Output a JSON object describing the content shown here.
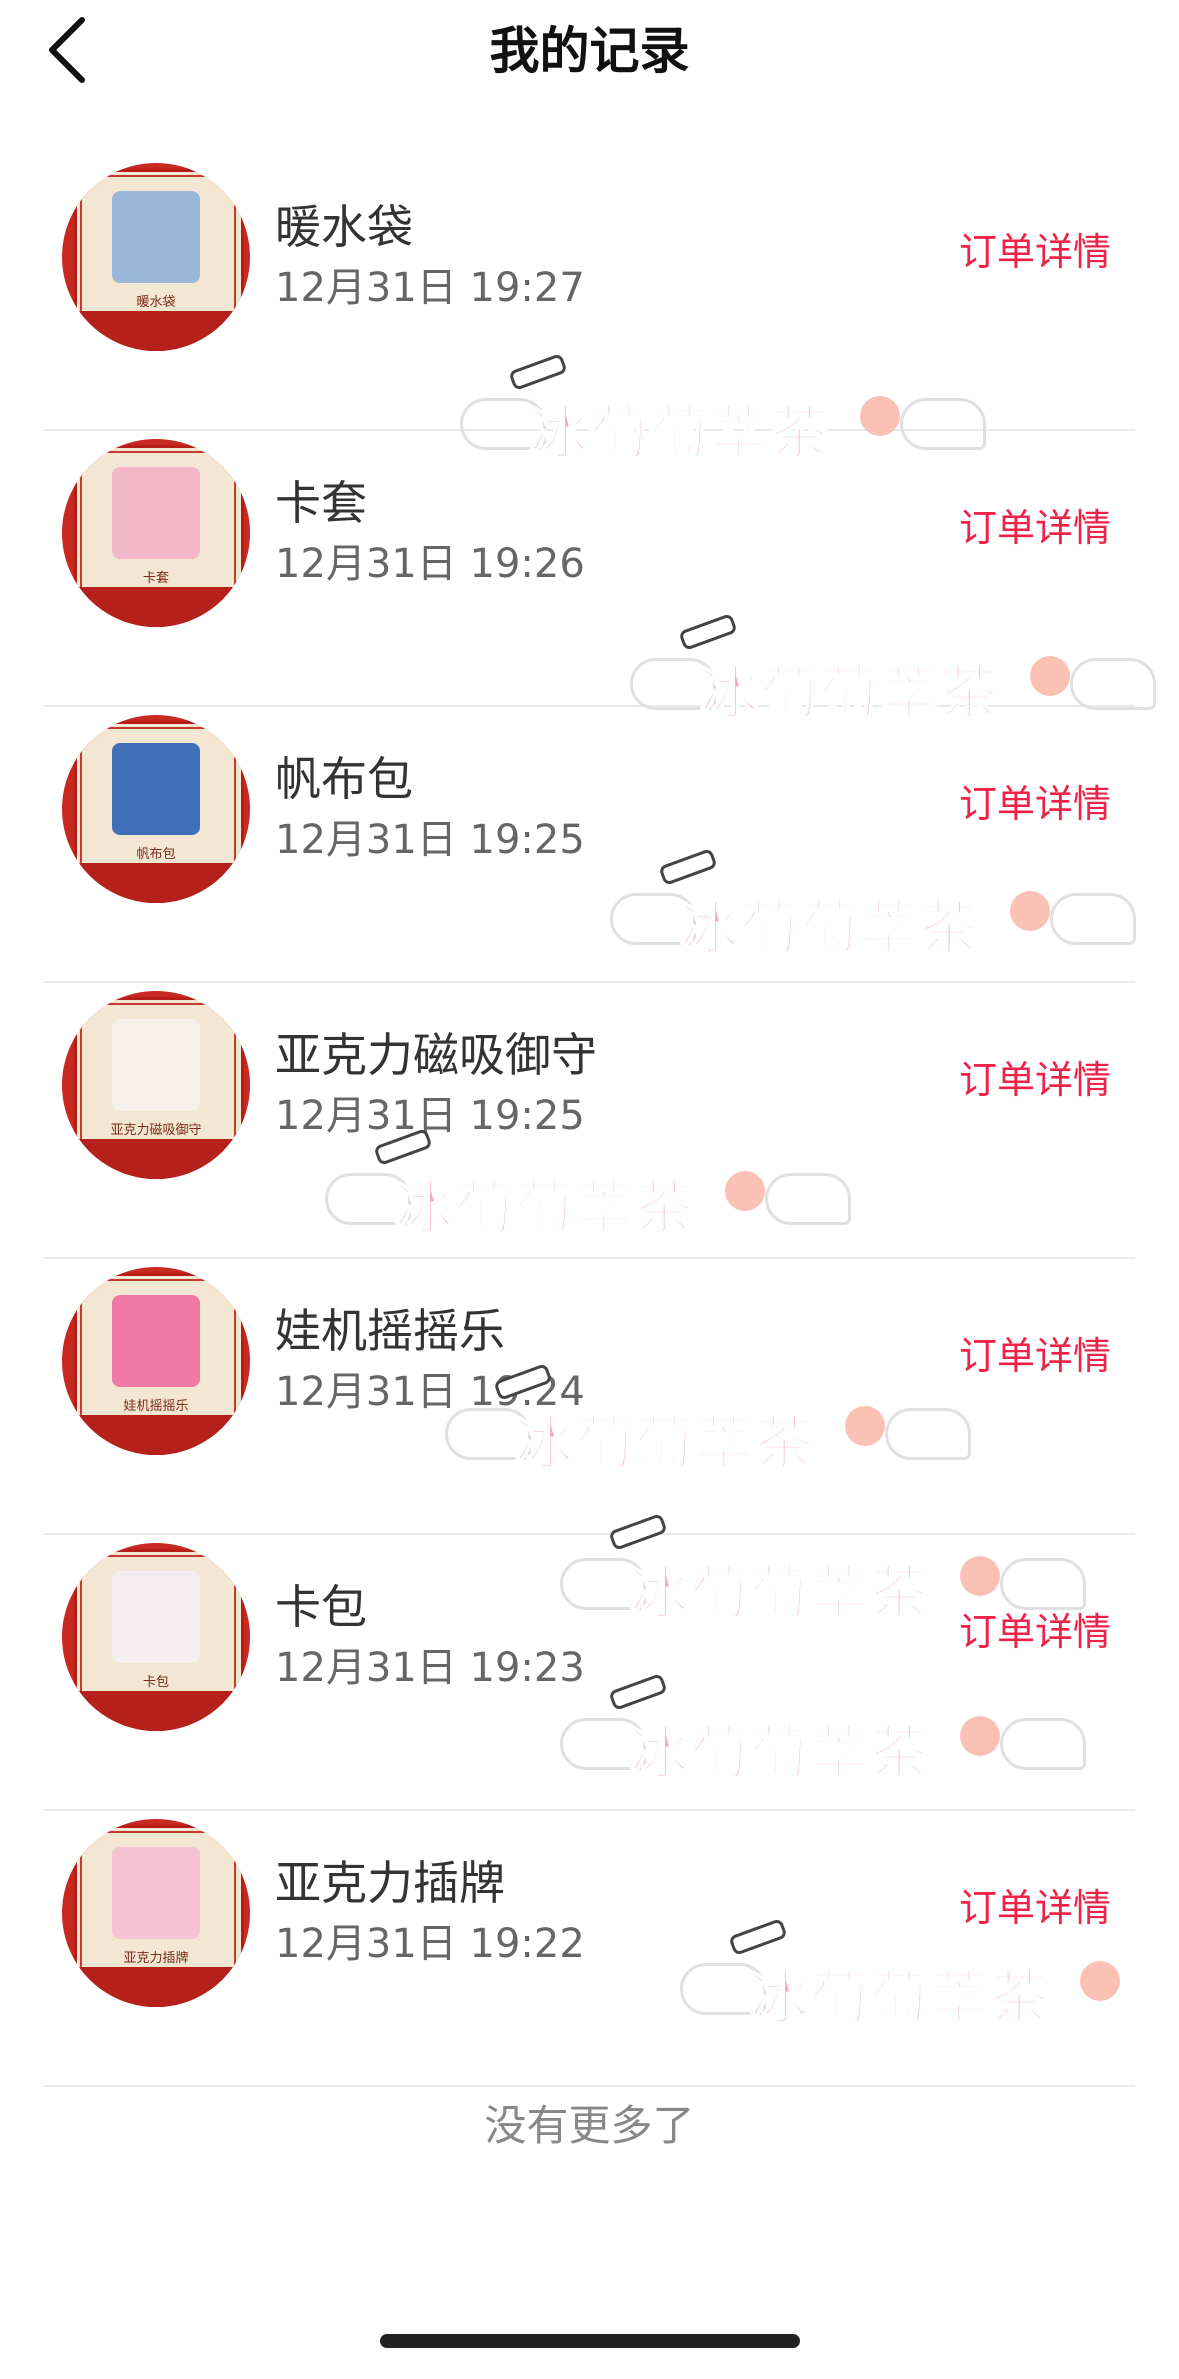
{
  "header": {
    "title": "我的记录"
  },
  "records": [
    {
      "name": "暖水袋",
      "time": "12月31日 19:27",
      "action": "订单详情",
      "thumb_caption": "暖水袋",
      "thumb_color": "#9bb7d8"
    },
    {
      "name": "卡套",
      "time": "12月31日 19:26",
      "action": "订单详情",
      "thumb_caption": "卡套",
      "thumb_color": "#f2b7c9"
    },
    {
      "name": "帆布包",
      "time": "12月31日 19:25",
      "action": "订单详情",
      "thumb_caption": "帆布包",
      "thumb_color": "#3f6fb8"
    },
    {
      "name": "亚克力磁吸御守",
      "time": "12月31日 19:25",
      "action": "订单详情",
      "thumb_caption": "亚克力磁吸御守",
      "thumb_color": "#f5f0ea"
    },
    {
      "name": "娃机摇摇乐",
      "time": "12月31日 19:24",
      "action": "订单详情",
      "thumb_caption": "娃机摇摇乐",
      "thumb_color": "#f07aa5"
    },
    {
      "name": "卡包",
      "time": "12月31日 19:23",
      "action": "订单详情",
      "thumb_caption": "卡包",
      "thumb_color": "#f4eef0"
    },
    {
      "name": "亚克力插牌",
      "time": "12月31日 19:22",
      "action": "订单详情",
      "thumb_caption": "亚克力插牌",
      "thumb_color": "#f4c2d3"
    }
  ],
  "footer": {
    "text": "没有更多了"
  },
  "watermark": {
    "text": "冰葡萄萃茶",
    "color": "#f7a3bf"
  },
  "colors": {
    "accent": "#f0224a",
    "thumb_frame": "#c7281f"
  }
}
